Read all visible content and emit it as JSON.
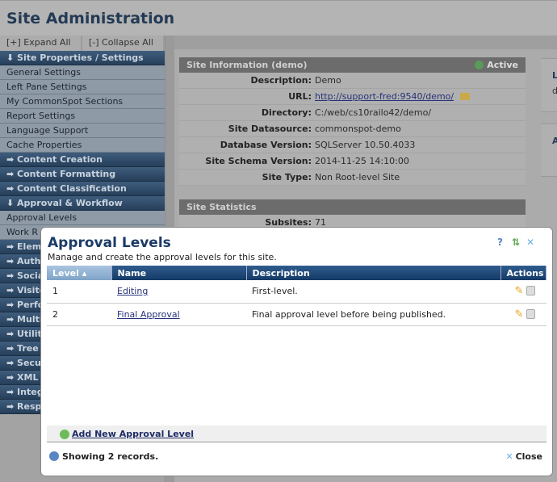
{
  "header": {
    "title": "Site Administration"
  },
  "sidebar": {
    "expand_all": "[+] Expand All",
    "collapse_all": "[-] Collapse All",
    "items": [
      {
        "type": "section",
        "label": "⬇ Site Properties / Settings"
      },
      {
        "type": "item",
        "label": "General Settings"
      },
      {
        "type": "item",
        "label": "Left Pane Settings"
      },
      {
        "type": "item",
        "label": "My CommonSpot Sections"
      },
      {
        "type": "item",
        "label": "Report Settings"
      },
      {
        "type": "item",
        "label": "Language Support"
      },
      {
        "type": "item",
        "label": "Cache Properties"
      },
      {
        "type": "section",
        "label": "➡ Content Creation"
      },
      {
        "type": "section",
        "label": "➡ Content Formatting"
      },
      {
        "type": "section",
        "label": "➡ Content Classification"
      },
      {
        "type": "section",
        "label": "⬇ Approval & Workflow"
      },
      {
        "type": "item",
        "label": "Approval Levels"
      },
      {
        "type": "item",
        "label": "Work R"
      },
      {
        "type": "section",
        "label": "➡ Elem"
      },
      {
        "type": "section",
        "label": "➡ Auth"
      },
      {
        "type": "section",
        "label": "➡ Socia"
      },
      {
        "type": "section",
        "label": "➡ Visito"
      },
      {
        "type": "section",
        "label": "➡ Perfo"
      },
      {
        "type": "section",
        "label": "➡ Multi"
      },
      {
        "type": "section",
        "label": "➡ Utiliti"
      },
      {
        "type": "section",
        "label": "➡ Tree"
      },
      {
        "type": "section",
        "label": "➡ Secu"
      },
      {
        "type": "section",
        "label": "➡ XML"
      },
      {
        "type": "section",
        "label": "➡ Integ"
      },
      {
        "type": "section",
        "label": "➡ Resp"
      }
    ]
  },
  "site_info": {
    "title": "Site Information (demo)",
    "status": "Active",
    "status_icon": "check-circle-icon",
    "rows": [
      {
        "label": "Description:",
        "value": "Demo"
      },
      {
        "label": "URL:",
        "value": "http://support-fred:9540/demo/",
        "link": true
      },
      {
        "label": "Directory:",
        "value": "C:/web/cs10railo42/demo/"
      },
      {
        "label": "Site Datasource:",
        "value": "commonspot-demo"
      },
      {
        "label": "Database Version:",
        "value": "SQLServer 10.50.4033"
      },
      {
        "label": "Site Schema Version:",
        "value": "2014-11-25 14:10:00"
      },
      {
        "label": "Site Type:",
        "value": "Non Root-level Site"
      }
    ]
  },
  "site_stats": {
    "title": "Site Statistics",
    "rows": [
      {
        "label": "Subsites:",
        "value": "71"
      }
    ]
  },
  "right_panel": {
    "a": "L",
    "b": "d",
    "c": "A"
  },
  "modal": {
    "title": "Approval Levels",
    "subtitle": "Manage and create the approval levels for this site.",
    "columns": [
      "Level ▴",
      "Name",
      "Description",
      "Actions"
    ],
    "rows": [
      {
        "level": "1",
        "name": "Editing",
        "description": "First-level."
      },
      {
        "level": "2",
        "name": "Final Approval",
        "description": "Final approval level before being published."
      }
    ],
    "add_label": "Add New Approval Level",
    "status": "Showing 2 records.",
    "close_label": "Close"
  }
}
